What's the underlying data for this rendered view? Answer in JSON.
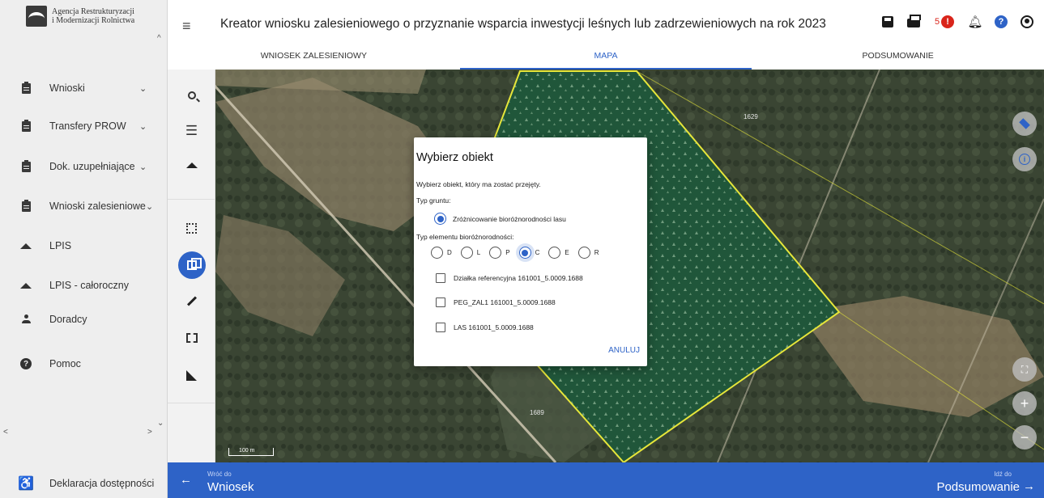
{
  "logo": {
    "line1": "Agencja Restrukturyzacji",
    "line2": "i Modernizacji Rolnictwa"
  },
  "sidebar": {
    "items": [
      {
        "label": "Wnioski",
        "icon": "clipboard-icon",
        "chevron": true
      },
      {
        "label": "Transfery PROW",
        "icon": "clipboard-icon",
        "chevron": true
      },
      {
        "label": "Dok. uzupełniające",
        "icon": "clipboard-icon",
        "chevron": true
      },
      {
        "label": "Wnioski zalesieniowe",
        "icon": "clipboard-icon",
        "chevron": true
      },
      {
        "label": "LPIS",
        "icon": "mountains-icon",
        "chevron": false
      },
      {
        "label": "LPIS - całoroczny",
        "icon": "mountains-icon",
        "chevron": false
      },
      {
        "label": "Doradcy",
        "icon": "person-icon",
        "chevron": false
      },
      {
        "label": "Pomoc",
        "icon": "help-icon",
        "chevron": false
      }
    ],
    "accessibility_label": "Deklaracja dostępności"
  },
  "header": {
    "title": "Kreator wniosku zalesieniowego o przyznanie wsparcia inwestycji leśnych lub zadrzewieniowych na rok 2023",
    "notification_count": "5"
  },
  "tabs": [
    {
      "label": "WNIOSEK ZALESIENIOWY",
      "active": false
    },
    {
      "label": "MAPA",
      "active": true
    },
    {
      "label": "PODSUMOWANIE",
      "active": false
    }
  ],
  "map": {
    "parcel_labels": [
      "1629",
      "1689"
    ],
    "scale_label": "100 m"
  },
  "dialog": {
    "title": "Wybierz obiekt",
    "subtitle": "Wybierz obiekt, który ma zostać przejęty.",
    "ground_type_label": "Typ gruntu:",
    "ground_type_option": "Zróżnicowanie bioróżnorodności lasu",
    "element_type_label": "Typ elementu bioróżnorodności:",
    "element_options": [
      "D",
      "L",
      "P",
      "C",
      "E",
      "R"
    ],
    "element_selected": "C",
    "checkbox_items": [
      "Działka referencyjna 161001_5.0009.1688",
      "PEG_ZAL1 161001_5.0009.1688",
      "LAS 161001_5.0009.1688"
    ],
    "cancel_label": "ANULUJ"
  },
  "bottom_bar": {
    "back_small": "Wróć do",
    "back_label": "Wniosek",
    "next_small": "Idź do",
    "next_label": "Podsumowanie"
  },
  "colors": {
    "accent": "#2e63c7",
    "alert": "#d9241a",
    "parcel_border": "#e6e63a",
    "parcel_fill": "#1f5d3c"
  }
}
